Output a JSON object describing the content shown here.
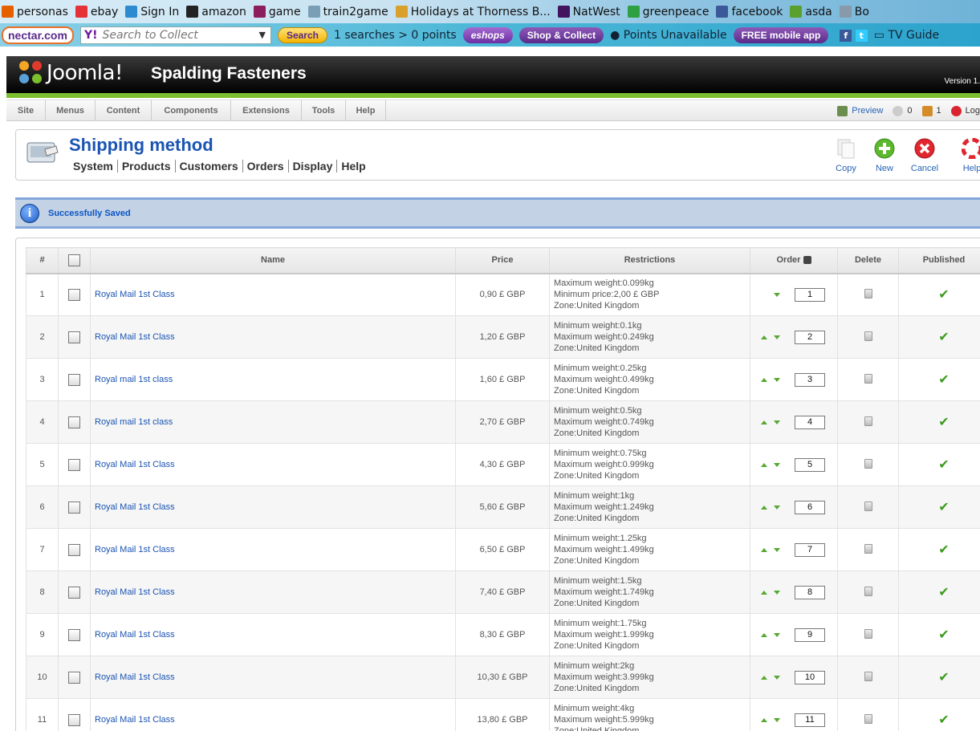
{
  "bookmarks": [
    {
      "label": "personas",
      "icon": "firefox-icon",
      "color": "#e66000"
    },
    {
      "label": "ebay",
      "icon": "ebay-icon",
      "color": "#e53238"
    },
    {
      "label": "Sign In",
      "icon": "windows-icon",
      "color": "#2e8bd0"
    },
    {
      "label": "amazon",
      "icon": "amazon-icon",
      "color": "#222222"
    },
    {
      "label": "game",
      "icon": "game-icon",
      "color": "#8c1d5e"
    },
    {
      "label": "train2game",
      "icon": "gamepad-icon",
      "color": "#7a9fb5"
    },
    {
      "label": "Holidays at Thorness B...",
      "icon": "holiday-icon",
      "color": "#d9a12b"
    },
    {
      "label": "NatWest",
      "icon": "natwest-icon",
      "color": "#42145f"
    },
    {
      "label": "greenpeace",
      "icon": "greenpeace-icon",
      "color": "#2ea043"
    },
    {
      "label": "facebook",
      "icon": "facebook-icon",
      "color": "#3b5998"
    },
    {
      "label": "asda",
      "icon": "asda-icon",
      "color": "#5aa02c"
    },
    {
      "label": "Bo",
      "icon": "bookmark-folder-icon",
      "color": "#8899aa"
    }
  ],
  "toolbar": {
    "nectar": "nectar.com",
    "search_placeholder": "Search to Collect",
    "search_button": "Search",
    "searches_points": "1 searches > 0 points",
    "eshops": "eshops",
    "shop_collect": "Shop & Collect",
    "points_unavailable": "Points Unavailable",
    "free_app": "FREE mobile app",
    "tv_guide": "TV Guide"
  },
  "header": {
    "logo_text": "Joomla!",
    "site_title": "Spalding Fasteners",
    "version": "Version 1."
  },
  "menu": [
    "Site",
    "Menus",
    "Content",
    "Components",
    "Extensions",
    "Tools",
    "Help"
  ],
  "status": {
    "preview": "Preview",
    "messages_count": "0",
    "users_count": "1",
    "logout": "Log"
  },
  "page": {
    "title": "Shipping method",
    "submenu": [
      "System",
      "Products",
      "Customers",
      "Orders",
      "Display",
      "Help"
    ],
    "buttons": {
      "copy": "Copy",
      "new": "New",
      "cancel": "Cancel",
      "help": "Help"
    }
  },
  "message": "Successfully Saved",
  "table": {
    "headers": {
      "num": "#",
      "name": "Name",
      "price": "Price",
      "restrictions": "Restrictions",
      "order": "Order",
      "delete": "Delete",
      "published": "Published"
    },
    "rows": [
      {
        "num": "1",
        "name": "Royal Mail 1st Class",
        "price": "0,90 £ GBP",
        "r1": "Maximum weight:0.099kg",
        "r2": "Minimum price:2,00 £ GBP",
        "r3": "Zone:United Kingdom",
        "order": "1",
        "up": false
      },
      {
        "num": "2",
        "name": "Royal Mail 1st Class",
        "price": "1,20 £ GBP",
        "r1": "Minimum weight:0.1kg",
        "r2": "Maximum weight:0.249kg",
        "r3": "Zone:United Kingdom",
        "order": "2",
        "up": true
      },
      {
        "num": "3",
        "name": "Royal mail 1st class",
        "price": "1,60 £ GBP",
        "r1": "Minimum weight:0.25kg",
        "r2": "Maximum weight:0.499kg",
        "r3": "Zone:United Kingdom",
        "order": "3",
        "up": true
      },
      {
        "num": "4",
        "name": "Royal mail 1st class",
        "price": "2,70 £ GBP",
        "r1": "Minimum weight:0.5kg",
        "r2": "Maximum weight:0.749kg",
        "r3": "Zone:United Kingdom",
        "order": "4",
        "up": true
      },
      {
        "num": "5",
        "name": "Royal Mail 1st Class",
        "price": "4,30 £ GBP",
        "r1": "Minimum weight:0.75kg",
        "r2": "Maximum weight:0.999kg",
        "r3": "Zone:United Kingdom",
        "order": "5",
        "up": true
      },
      {
        "num": "6",
        "name": "Royal Mail 1st Class",
        "price": "5,60 £ GBP",
        "r1": "Minimum weight:1kg",
        "r2": "Maximum weight:1.249kg",
        "r3": "Zone:United Kingdom",
        "order": "6",
        "up": true
      },
      {
        "num": "7",
        "name": "Royal Mail 1st Class",
        "price": "6,50 £ GBP",
        "r1": "Minimum weight:1.25kg",
        "r2": "Maximum weight:1.499kg",
        "r3": "Zone:United Kingdom",
        "order": "7",
        "up": true
      },
      {
        "num": "8",
        "name": "Royal Mail 1st Class",
        "price": "7,40 £ GBP",
        "r1": "Minimum weight:1.5kg",
        "r2": "Maximum weight:1.749kg",
        "r3": "Zone:United Kingdom",
        "order": "8",
        "up": true
      },
      {
        "num": "9",
        "name": "Royal Mail 1st Class",
        "price": "8,30 £ GBP",
        "r1": "Minimum weight:1.75kg",
        "r2": "Maximum weight:1.999kg",
        "r3": "Zone:United Kingdom",
        "order": "9",
        "up": true
      },
      {
        "num": "10",
        "name": "Royal Mail 1st Class",
        "price": "10,30 £ GBP",
        "r1": "Minimum weight:2kg",
        "r2": "Maximum weight:3.999kg",
        "r3": "Zone:United Kingdom",
        "order": "10",
        "up": true
      },
      {
        "num": "11",
        "name": "Royal Mail 1st Class",
        "price": "13,80 £ GBP",
        "r1": "Minimum weight:4kg",
        "r2": "Maximum weight:5.999kg",
        "r3": "Zone:United Kingdom",
        "order": "11",
        "up": true
      }
    ]
  },
  "colors": {
    "accent": "#1a54b2",
    "header_bg": "#000000",
    "green_bar": "#7cbf2e",
    "message_bg": "#c3d2e5",
    "published": "#3c9b1d"
  }
}
